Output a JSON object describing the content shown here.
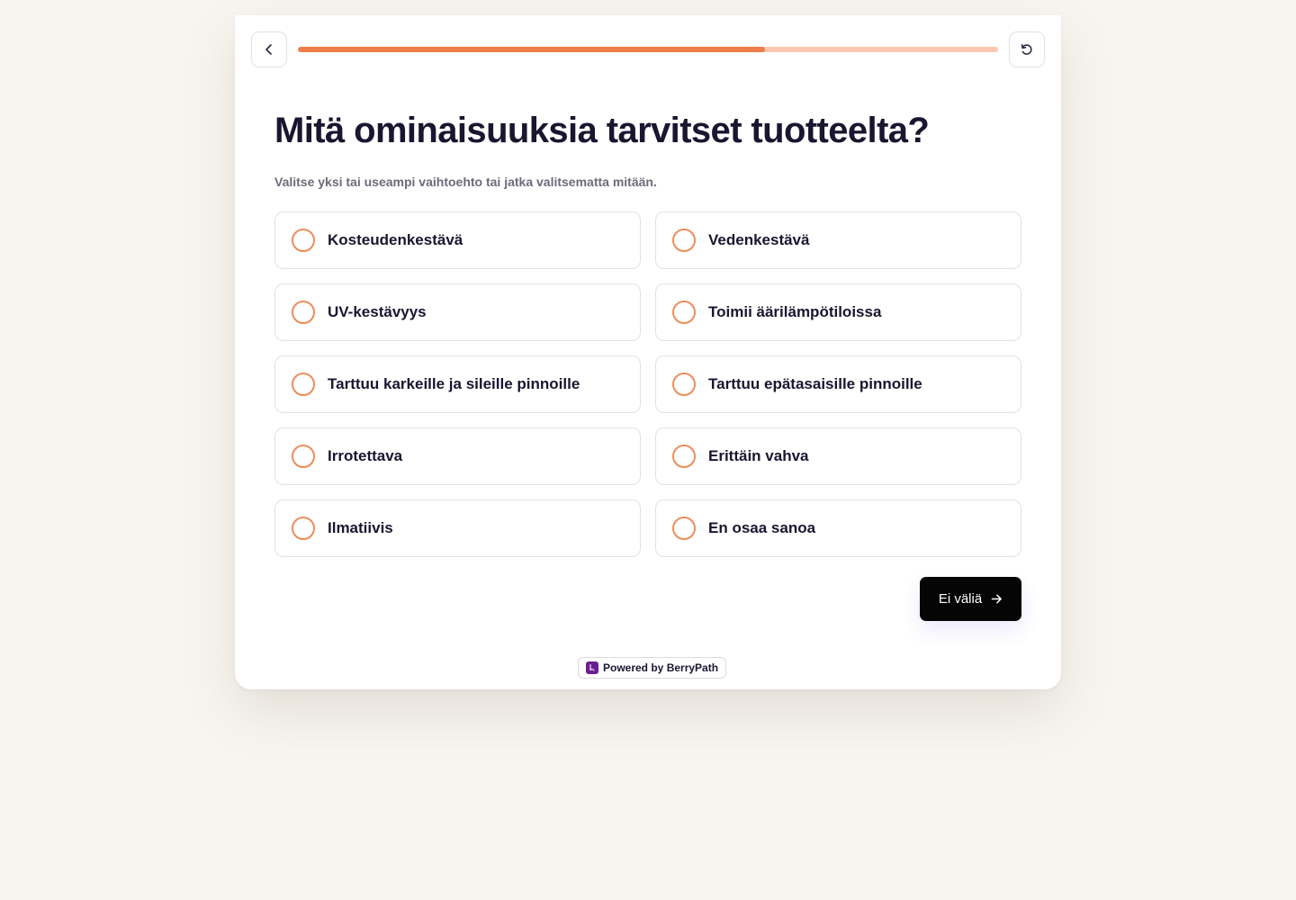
{
  "header": {
    "back_icon": "chevron-left-icon",
    "restart_icon": "restart-icon",
    "progress": 0.667
  },
  "question": {
    "title": "Mitä ominaisuuksia tarvitset tuotteelta?",
    "subtitle": "Valitse yksi tai useampi vaihtoehto tai jatka valitsematta mitään."
  },
  "options": [
    {
      "label": "Kosteudenkestävä",
      "selected": false
    },
    {
      "label": "Vedenkestävä",
      "selected": false
    },
    {
      "label": "UV-kestävyys",
      "selected": false
    },
    {
      "label": "Toimii äärilämpötiloissa",
      "selected": false
    },
    {
      "label": "Tarttuu karkeille ja sileille pinnoille",
      "selected": false
    },
    {
      "label": "Tarttuu epätasaisille pinnoille",
      "selected": false
    },
    {
      "label": "Irrotettava",
      "selected": false
    },
    {
      "label": "Erittäin vahva",
      "selected": false
    },
    {
      "label": "Ilmatiivis",
      "selected": false
    },
    {
      "label": "En osaa sanoa",
      "selected": false
    }
  ],
  "actions": {
    "skip_label": "Ei väliä",
    "skip_icon": "arrow-right-icon"
  },
  "footer": {
    "powered_by": "Powered by BerryPath",
    "logo_icon": "berrypath-logo-icon"
  },
  "colors": {
    "accent": "#ee7e49",
    "accent_light": "#fcc8b1",
    "background": "#f8f5f0",
    "text": "#1b1530",
    "button": "#050505",
    "brand": "#6b1e8f"
  }
}
